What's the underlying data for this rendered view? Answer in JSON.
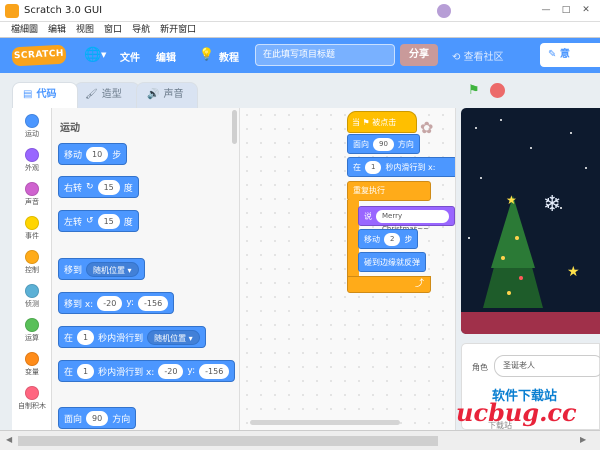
{
  "window": {
    "title": "Scratch 3.0 GUI",
    "controls": [
      "—",
      "□",
      "✕"
    ]
  },
  "menubar": [
    "檔細圖",
    "编辑",
    "视图",
    "窗口",
    "导航",
    "新开窗口"
  ],
  "topbar": {
    "logo": "SCRATCH",
    "file": "文件",
    "edit": "编辑",
    "tutorials": "教程",
    "project_title_placeholder": "在此填写项目标题",
    "share": "分享",
    "community": "查看社区",
    "save": "意"
  },
  "tabs": [
    {
      "label": "代码"
    },
    {
      "label": "造型"
    },
    {
      "label": "声音"
    }
  ],
  "categories": [
    {
      "label": "运动",
      "color": "#4c97ff"
    },
    {
      "label": "外观",
      "color": "#9966ff"
    },
    {
      "label": "声音",
      "color": "#cf63cf"
    },
    {
      "label": "事件",
      "color": "#ffd500"
    },
    {
      "label": "控制",
      "color": "#ffab19"
    },
    {
      "label": "侦测",
      "color": "#5cb1d6"
    },
    {
      "label": "运算",
      "color": "#59c059"
    },
    {
      "label": "变量",
      "color": "#ff8c1a"
    },
    {
      "label": "自制积木",
      "color": "#ff6680"
    }
  ],
  "palette": {
    "title": "运动",
    "move": {
      "pre": "移动",
      "val": "10",
      "post": "步"
    },
    "turn_right": {
      "pre": "右转",
      "val": "15",
      "post": "度"
    },
    "turn_left": {
      "pre": "左转",
      "val": "15",
      "post": "度"
    },
    "goto": {
      "pre": "移到",
      "dd": "随机位置 ▾"
    },
    "goto_xy": {
      "pre": "移到 x:",
      "x": "-20",
      "ylbl": "y:",
      "y": "-156"
    },
    "glide_to": {
      "pre": "在",
      "val": "1",
      "mid": "秒内滑行到",
      "dd": "随机位置 ▾"
    },
    "glide_xy": {
      "pre": "在",
      "val": "1",
      "mid": "秒内滑行到 x:",
      "x": "-20",
      "ylbl": "y:",
      "y": "-156"
    },
    "point": {
      "pre": "面向",
      "val": "90",
      "post": "方向"
    }
  },
  "script": {
    "hat": "当 ⚑ 被点击",
    "point": {
      "pre": "面向",
      "val": "90",
      "post": "方向"
    },
    "glide": {
      "pre": "在",
      "val": "1",
      "mid": "秒内滑行到 x:"
    },
    "forever": "重复执行",
    "say": {
      "pre": "说",
      "val": "Merry Christmas~~"
    },
    "move": {
      "pre": "移动",
      "val": "2",
      "post": "步"
    },
    "bounce": "碰到边缘就反弹",
    "loop_arrow": "⤴"
  },
  "sprite_panel": {
    "label": "角色",
    "name": "圣诞老人"
  },
  "watermark": {
    "top": "软件下载站",
    "main": "ucbug.cc",
    "sub": "下载站"
  }
}
